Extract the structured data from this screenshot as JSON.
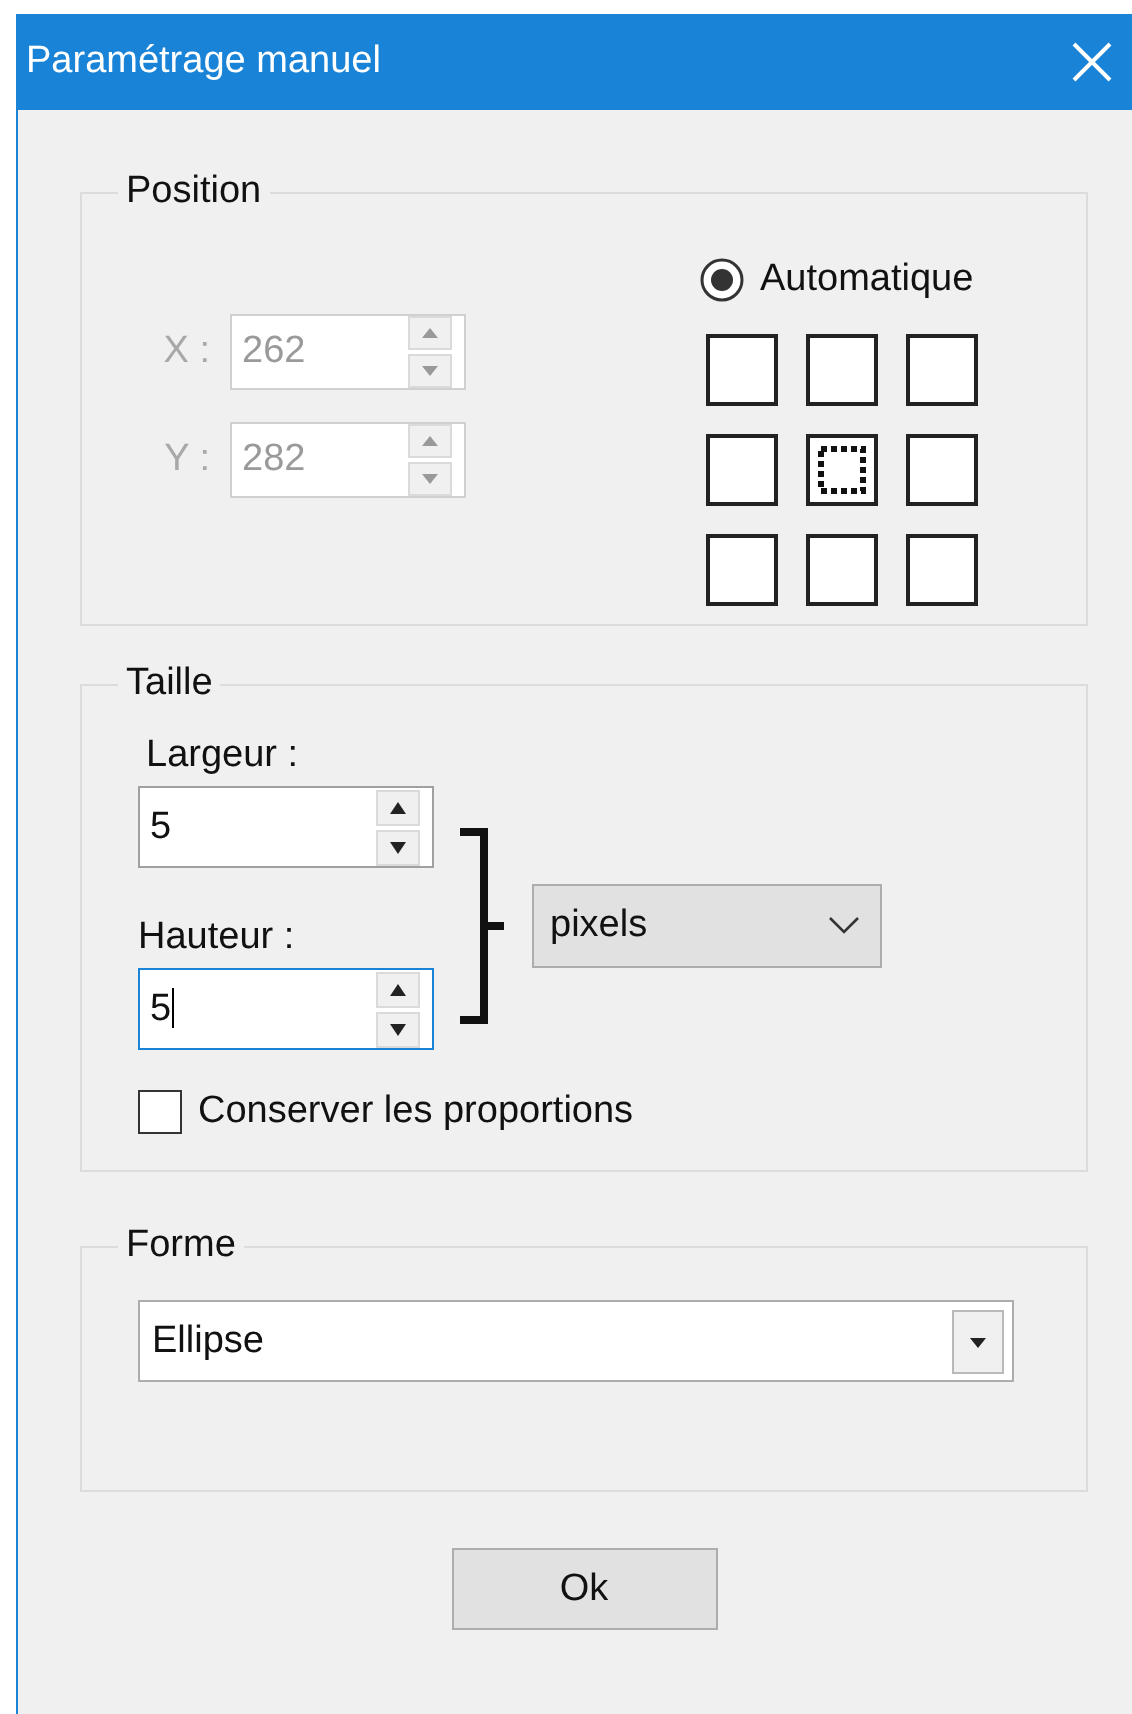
{
  "window": {
    "title": "Paramétrage manuel"
  },
  "position": {
    "title": "Position",
    "fields": [
      {
        "label": "X :",
        "value": "262",
        "disabled": true
      },
      {
        "label": "Y :",
        "value": "282",
        "disabled": true
      }
    ],
    "automatic": {
      "label": "Automatique",
      "selected": true
    },
    "anchors": [
      {
        "selected": false
      },
      {
        "selected": false
      },
      {
        "selected": false
      },
      {
        "selected": false
      },
      {
        "selected": true
      },
      {
        "selected": false
      },
      {
        "selected": false
      },
      {
        "selected": false
      },
      {
        "selected": false
      }
    ]
  },
  "size": {
    "title": "Taille",
    "fields": [
      {
        "label": "Largeur :",
        "value": "5",
        "focused": false
      },
      {
        "label": "Hauteur :",
        "value": "5",
        "focused": true
      }
    ],
    "unit": "pixels",
    "keep_ratio": {
      "label": "Conserver les proportions",
      "checked": false
    }
  },
  "shape": {
    "title": "Forme",
    "value": "Ellipse"
  },
  "buttons": [
    "Ok"
  ]
}
